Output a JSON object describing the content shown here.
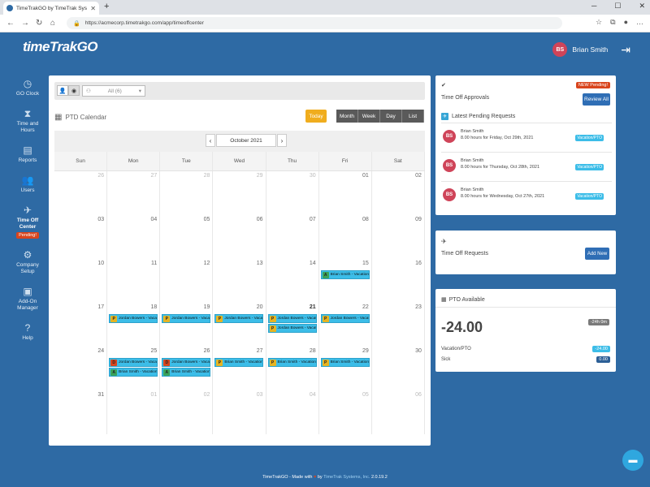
{
  "browser": {
    "tab_title": "TimeTrakGO by TimeTrak Systems",
    "url": "https://acmecorp.timetrakgo.com/app/timeoffcenter"
  },
  "header": {
    "logo_time": "time",
    "logo_trak": "Trak",
    "logo_go": "GO",
    "user_initials": "BS",
    "user_name": "Brian Smith"
  },
  "sidebar": {
    "items": [
      {
        "label": "GO Clock",
        "icon": "clock-icon"
      },
      {
        "label": "Time and Hours",
        "icon": "hourglass-icon"
      },
      {
        "label": "Reports",
        "icon": "document-icon"
      },
      {
        "label": "Users",
        "icon": "users-icon"
      },
      {
        "label": "Time Off Center",
        "icon": "plane-icon",
        "badge": "Pending!"
      },
      {
        "label": "Company Setup",
        "icon": "gear-icon"
      },
      {
        "label": "Add-On Manager",
        "icon": "addon-icon"
      },
      {
        "label": "Help",
        "icon": "help-icon"
      }
    ]
  },
  "calendar": {
    "filter_value": "All (6)",
    "title": "PTD Calendar",
    "today_label": "Today",
    "views": [
      "Month",
      "Week",
      "Day",
      "List"
    ],
    "month_label": "October 2021",
    "weekdays": [
      "Sun",
      "Mon",
      "Tue",
      "Wed",
      "Thu",
      "Fri",
      "Sat"
    ],
    "weeks": [
      [
        "26",
        "27",
        "28",
        "29",
        "30",
        "01",
        "02"
      ],
      [
        "03",
        "04",
        "05",
        "06",
        "07",
        "08",
        "09"
      ],
      [
        "10",
        "11",
        "12",
        "13",
        "14",
        "15",
        "16"
      ],
      [
        "17",
        "18",
        "19",
        "20",
        "21",
        "22",
        "23"
      ],
      [
        "24",
        "25",
        "26",
        "27",
        "28",
        "29",
        "30"
      ],
      [
        "31",
        "01",
        "02",
        "03",
        "04",
        "05",
        "06"
      ]
    ],
    "events": [
      {
        "week": 2,
        "day": 5,
        "slot": 0,
        "code": "A",
        "text": "Brian Smith - Vacation/..."
      },
      {
        "week": 3,
        "day": 1,
        "slot": 0,
        "code": "P",
        "text": "Jordan Bowers - Vacati..."
      },
      {
        "week": 3,
        "day": 2,
        "slot": 0,
        "code": "P",
        "text": "Jordan Bowers - Vacati..."
      },
      {
        "week": 3,
        "day": 3,
        "slot": 0,
        "code": "P",
        "text": "Jordan Bowers - Vacati..."
      },
      {
        "week": 3,
        "day": 4,
        "slot": 0,
        "code": "P",
        "text": "Jordan Bowers - Vacati..."
      },
      {
        "week": 3,
        "day": 4,
        "slot": 1,
        "code": "P",
        "text": "Jordan Bowers - Vacati..."
      },
      {
        "week": 3,
        "day": 5,
        "slot": 0,
        "code": "P",
        "text": "Jordan Bowers - Vacati..."
      },
      {
        "week": 4,
        "day": 1,
        "slot": 0,
        "code": "D",
        "text": "Jordan Bowers - Vacati..."
      },
      {
        "week": 4,
        "day": 1,
        "slot": 1,
        "code": "A",
        "text": "Brian Smith - Vacation/..."
      },
      {
        "week": 4,
        "day": 2,
        "slot": 0,
        "code": "D",
        "text": "Jordan Bowers - Vacati..."
      },
      {
        "week": 4,
        "day": 2,
        "slot": 1,
        "code": "A",
        "text": "Brian Smith - Vacation/..."
      },
      {
        "week": 4,
        "day": 3,
        "slot": 0,
        "code": "P",
        "text": "Brian Smith - Vacation/..."
      },
      {
        "week": 4,
        "day": 4,
        "slot": 0,
        "code": "P",
        "text": "Brian Smith - Vacation/..."
      },
      {
        "week": 4,
        "day": 5,
        "slot": 0,
        "code": "P",
        "text": "Brian Smith - Vacation/..."
      }
    ]
  },
  "approvals": {
    "title": "Time Off Approvals",
    "new_badge": "NEW Pending!",
    "review_label": "Review All",
    "latest_label": "Latest Pending Requests",
    "requests": [
      {
        "initials": "BS",
        "name": "Brian Smith",
        "desc": "8.00 hours for Friday, Oct 29th, 2021",
        "tag": "Vacation/PTO"
      },
      {
        "initials": "BS",
        "name": "Brian Smith",
        "desc": "8.00 hours for Thursday, Oct 28th, 2021",
        "tag": "Vacation/PTO"
      },
      {
        "initials": "BS",
        "name": "Brian Smith",
        "desc": "8.00 hours for Wednesday, Oct 27th, 2021",
        "tag": "Vacation/PTO"
      }
    ]
  },
  "requests_card": {
    "title": "Time Off Requests",
    "add_label": "Add New"
  },
  "pto": {
    "title": "PTO Available",
    "total": "-24.00",
    "badge": "-24h 0m",
    "rows": [
      {
        "label": "Vacation/PTO",
        "value": "-24.00"
      },
      {
        "label": "Sick",
        "value": "0.00"
      }
    ]
  },
  "footer": {
    "prefix": "TimeTrakGO - Made with",
    "by": "by",
    "company": "TimeTrak Systems, Inc.",
    "version": "2.0.19.2"
  }
}
